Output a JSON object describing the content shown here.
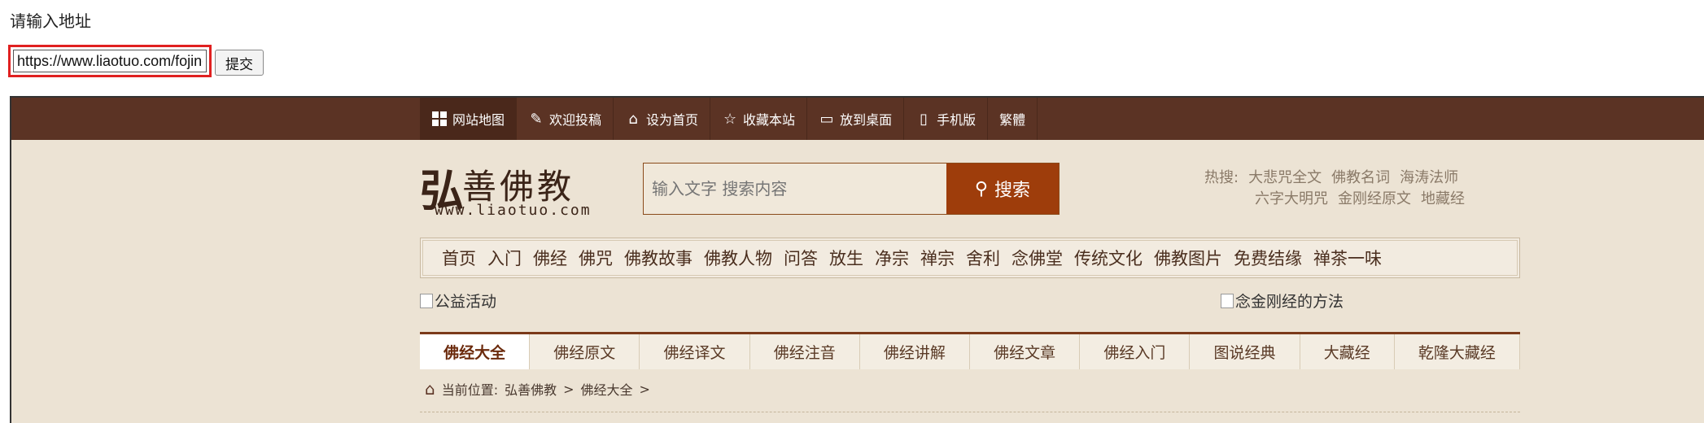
{
  "page": {
    "prompt": "请输入地址",
    "url_value": "https://www.liaotuo.com/fojing",
    "submit_label": "提交"
  },
  "topbar": {
    "items": [
      {
        "label": "网站地图",
        "icon": "grid-icon"
      },
      {
        "label": "欢迎投稿",
        "icon": "pen-icon"
      },
      {
        "label": "设为首页",
        "icon": "home-icon"
      },
      {
        "label": "收藏本站",
        "icon": "star-icon"
      },
      {
        "label": "放到桌面",
        "icon": "monitor-icon"
      },
      {
        "label": "手机版",
        "icon": "phone-icon"
      },
      {
        "label": "繁體",
        "icon": ""
      }
    ]
  },
  "logo": {
    "mark": "弘",
    "name": "善佛教",
    "url": "www.liaotuo.com"
  },
  "search": {
    "placeholder": "输入文字 搜索内容",
    "button_label": "搜索"
  },
  "hot": {
    "label": "热搜:",
    "row1": [
      "大悲咒全文",
      "佛教名词",
      "海涛法师"
    ],
    "row2": [
      "六字大明咒",
      "金刚经原文",
      "地藏经"
    ]
  },
  "mainnav": [
    "首页",
    "入门",
    "佛经",
    "佛咒",
    "佛教故事",
    "佛教人物",
    "问答",
    "放生",
    "净宗",
    "禅宗",
    "舍利",
    "念佛堂",
    "传统文化",
    "佛教图片",
    "免费结缘",
    "禅茶一味"
  ],
  "images": {
    "left_alt": "公益活动",
    "right_alt": "念金刚经的方法"
  },
  "tabs": [
    "佛经大全",
    "佛经原文",
    "佛经译文",
    "佛经注音",
    "佛经讲解",
    "佛经文章",
    "佛经入门",
    "图说经典",
    "大藏经",
    "乾隆大藏经"
  ],
  "breadcrumb": {
    "prefix": "当前位置:",
    "items": [
      "弘善佛教",
      ">",
      "佛经大全",
      ">"
    ]
  },
  "colors": {
    "topbar": "#5b3324",
    "accent": "#9e3d0b",
    "background": "#ece3d4"
  }
}
